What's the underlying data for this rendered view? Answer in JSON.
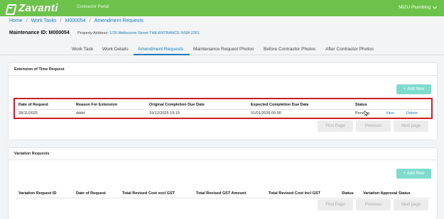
{
  "header": {
    "logo_text": "Zavanti",
    "portal_label": "Contractor Portal",
    "user_label": "MIZU Plumbing",
    "brand_color": "#6cc24a"
  },
  "breadcrumb": [
    "Home",
    "Work Tasks",
    "M000054",
    "Amendment Requests"
  ],
  "maintenance": {
    "title": "Maintenance ID: M000054",
    "address_label": "Property Address:",
    "address_value": "1/26 Melbourne Street THE ENTRANCE NSW 2261"
  },
  "tabs": [
    {
      "label": "Work Task"
    },
    {
      "label": "Work Details"
    },
    {
      "label": "Amendment Requests",
      "active": true
    },
    {
      "label": "Maintenance Request Photos"
    },
    {
      "label": "Before Contractor Photos"
    },
    {
      "label": "After Contractor Photos"
    }
  ],
  "extension": {
    "title": "Extension of Time Request",
    "add_label": "Add New",
    "columns": [
      "Date of Request",
      "Reason For Extension",
      "Original Completion Due Date",
      "Expected Completion Due Date",
      "Status"
    ],
    "row": {
      "date": "28/11/2025",
      "reason": "dddd",
      "original": "19/12/2025 19:19",
      "expected": "01/01/2026 00:00",
      "status": "Pending",
      "view": "View",
      "delete": "Delete"
    },
    "pager": {
      "first": "First Page",
      "previous": "Previous",
      "next": "Next page"
    }
  },
  "variation": {
    "title": "Variation Requests",
    "add_label": "Add New",
    "columns": [
      "Variation Request ID",
      "Date of Request",
      "Total Revised Cost excl GST",
      "Total Revised GST Amount",
      "Total Revised Cost incl GST",
      "Status",
      "Variation Approval Status"
    ],
    "pager": {
      "first": "First Page",
      "previous": "Previous",
      "next": "Next page"
    }
  }
}
